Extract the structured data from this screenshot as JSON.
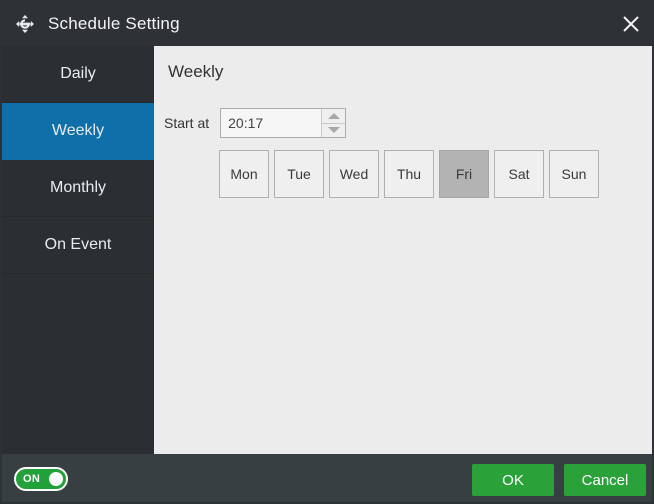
{
  "titlebar": {
    "icon": "move-arrows-icon",
    "title": "Schedule Setting",
    "close_label": "×"
  },
  "sidebar": {
    "items": [
      {
        "label": "Daily",
        "active": false
      },
      {
        "label": "Weekly",
        "active": true
      },
      {
        "label": "Monthly",
        "active": false
      },
      {
        "label": "On Event",
        "active": false
      }
    ]
  },
  "content": {
    "title": "Weekly",
    "start_at_label": "Start at",
    "start_at_value": "20:17",
    "start_at_placeholder": "HH:MM",
    "spinner_up": "increase-time",
    "spinner_down": "decrease-time",
    "days": [
      {
        "label": "Mon",
        "selected": false
      },
      {
        "label": "Tue",
        "selected": false
      },
      {
        "label": "Wed",
        "selected": false
      },
      {
        "label": "Thu",
        "selected": false
      },
      {
        "label": "Fri",
        "selected": true
      },
      {
        "label": "Sat",
        "selected": false
      },
      {
        "label": "Sun",
        "selected": false
      }
    ]
  },
  "footer": {
    "toggle_label": "ON",
    "ok_label": "OK",
    "cancel_label": "Cancel"
  },
  "colors": {
    "titlebar_bg": "#2E3236",
    "sidebar_bg": "#2B2F33",
    "sidebar_active": "#0F6FA8",
    "content_bg": "#ECECEC",
    "footer_bg": "#383F42",
    "accent_green": "#2BA13A",
    "day_selected": "#B3B3B3"
  }
}
